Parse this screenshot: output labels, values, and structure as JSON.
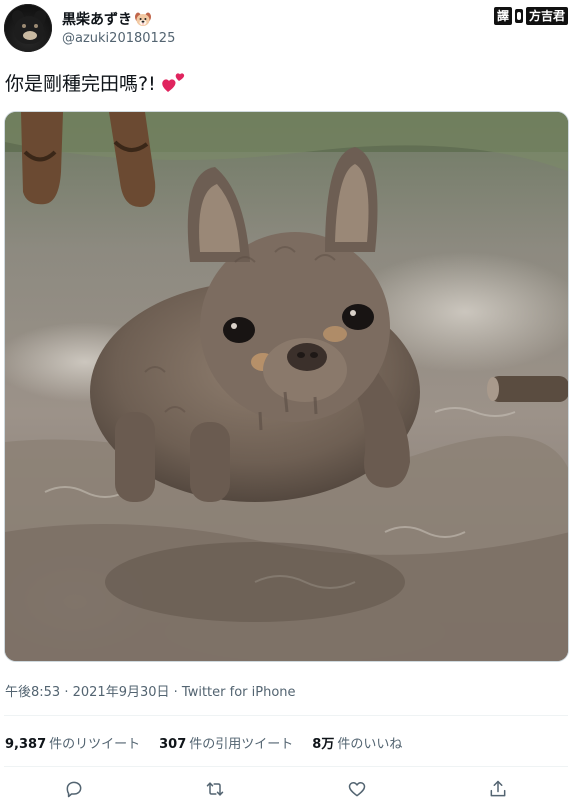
{
  "user": {
    "display_name": "黒柴あずき",
    "name_emoji": "dog-face-icon",
    "handle": "@azuki20180125"
  },
  "watermark": {
    "part1": "譯",
    "part2": "方吉君"
  },
  "tweet": {
    "text": "你是剛種完田嗎?!",
    "emoji": "two-hearts-icon"
  },
  "photo": {
    "subject": "mud-covered-french-bulldog"
  },
  "meta": {
    "time": "午後8:53",
    "separator1": " · ",
    "date": "2021年9月30日",
    "separator2": " · ",
    "source": "Twitter for iPhone"
  },
  "stats": {
    "retweets_count": "9,387",
    "retweets_label": "件のリツイート",
    "quotes_count": "307",
    "quotes_label": "件の引用ツイート",
    "likes_count": "8万",
    "likes_label": "件のいいね"
  },
  "actions": {
    "reply_icon": "reply-icon",
    "retweet_icon": "retweet-icon",
    "like_icon": "like-icon",
    "share_icon": "share-icon"
  },
  "colors": {
    "text_primary": "#0f1419",
    "text_secondary": "#536471",
    "divider": "#eff3f4",
    "heart": "#e0245e"
  }
}
